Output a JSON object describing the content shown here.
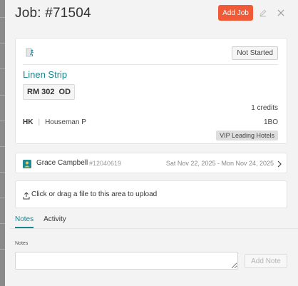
{
  "header": {
    "title": "Job: #71504",
    "add_job_label": "Add Job",
    "icons": {
      "edit": "pencil-icon",
      "close": "close-icon"
    }
  },
  "job": {
    "status": "Not Started",
    "item_name": "Linen Strip",
    "room": "RM 302",
    "room_status": "OD",
    "credits": "1 credits",
    "department_code": "HK",
    "department_name": "Houseman P",
    "stay_code": "1BO",
    "vip": "VIP Leading Hotels",
    "icon": "runner-icon"
  },
  "guest": {
    "name": "Grace Campbell",
    "id": "#12040619",
    "dates": "Sat Nov 22, 2025 - Mon Nov 24, 2025",
    "icon": "person-icon"
  },
  "upload": {
    "text": "Click or drag a file to this area to upload",
    "icon": "upload-icon"
  },
  "tabs": [
    {
      "label": "Notes",
      "active": true
    },
    {
      "label": "Activity",
      "active": false
    }
  ],
  "notes": {
    "label": "Notes",
    "placeholder": "",
    "add_note_label": "Add Note"
  },
  "colors": {
    "accent": "#16858c",
    "primary_button": "#f05a36"
  }
}
